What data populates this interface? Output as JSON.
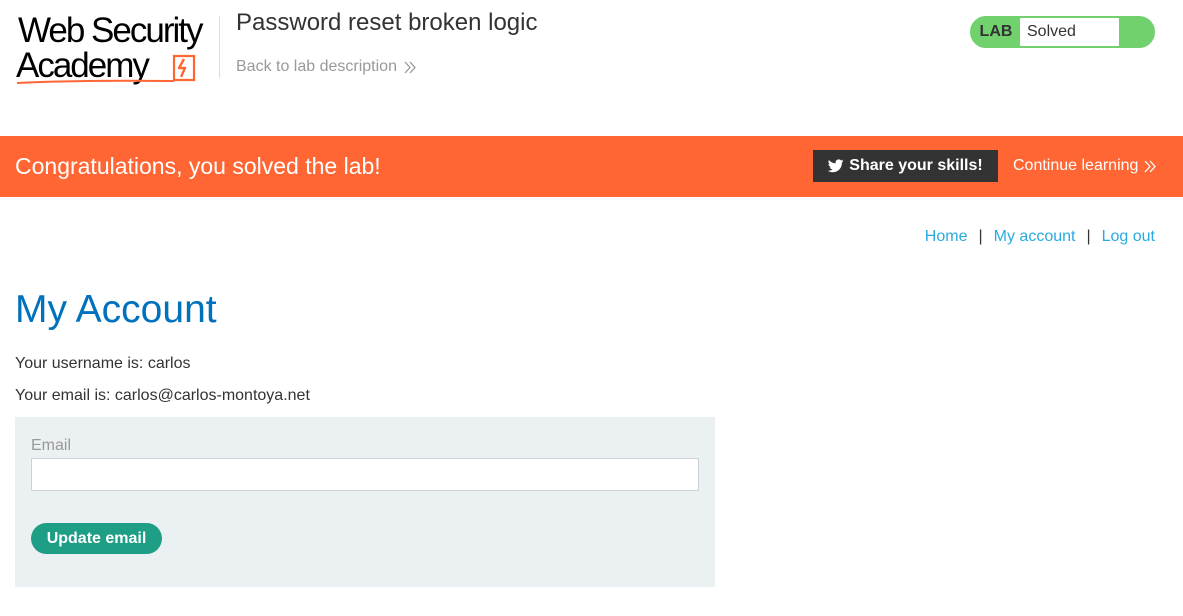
{
  "header": {
    "logo_line1": "Web Security",
    "logo_line2": "Academy",
    "lab_title": "Password reset broken logic",
    "back_link": "Back to lab description",
    "lab_status": {
      "tag": "LAB",
      "state": "Solved",
      "color": "#70d16d"
    }
  },
  "banner": {
    "message": "Congratulations, you solved the lab!",
    "share_label": "Share your skills!",
    "continue_label": "Continue learning",
    "color": "#ff6633"
  },
  "nav": {
    "items": [
      {
        "label": "Home"
      },
      {
        "label": "My account"
      },
      {
        "label": "Log out"
      }
    ],
    "separator": "|"
  },
  "main": {
    "title": "My Account",
    "username_line": "Your username is: carlos",
    "email_line": "Your email is: carlos@carlos-montoya.net",
    "form": {
      "email_label": "Email",
      "email_value": "",
      "submit_label": "Update email"
    }
  },
  "icons": {
    "back": "double-chevron-right-icon",
    "share": "twitter-icon",
    "continue": "double-chevron-right-icon",
    "logo": "academy-lightning-icon"
  }
}
